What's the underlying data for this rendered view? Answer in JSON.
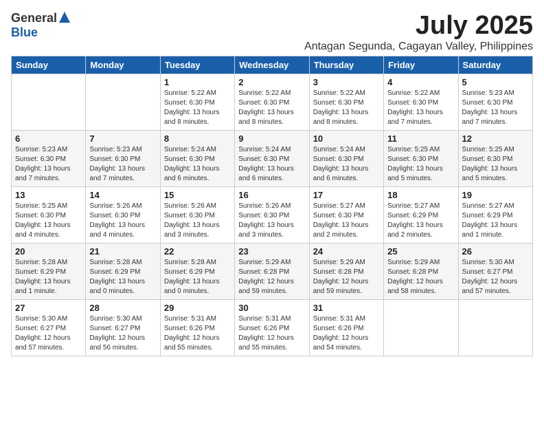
{
  "logo": {
    "general": "General",
    "blue": "Blue"
  },
  "title": "July 2025",
  "subtitle": "Antagan Segunda, Cagayan Valley, Philippines",
  "weekdays": [
    "Sunday",
    "Monday",
    "Tuesday",
    "Wednesday",
    "Thursday",
    "Friday",
    "Saturday"
  ],
  "weeks": [
    [
      {
        "day": null,
        "info": null
      },
      {
        "day": null,
        "info": null
      },
      {
        "day": "1",
        "info": "Sunrise: 5:22 AM\nSunset: 6:30 PM\nDaylight: 13 hours and 8 minutes."
      },
      {
        "day": "2",
        "info": "Sunrise: 5:22 AM\nSunset: 6:30 PM\nDaylight: 13 hours and 8 minutes."
      },
      {
        "day": "3",
        "info": "Sunrise: 5:22 AM\nSunset: 6:30 PM\nDaylight: 13 hours and 8 minutes."
      },
      {
        "day": "4",
        "info": "Sunrise: 5:22 AM\nSunset: 6:30 PM\nDaylight: 13 hours and 7 minutes."
      },
      {
        "day": "5",
        "info": "Sunrise: 5:23 AM\nSunset: 6:30 PM\nDaylight: 13 hours and 7 minutes."
      }
    ],
    [
      {
        "day": "6",
        "info": "Sunrise: 5:23 AM\nSunset: 6:30 PM\nDaylight: 13 hours and 7 minutes."
      },
      {
        "day": "7",
        "info": "Sunrise: 5:23 AM\nSunset: 6:30 PM\nDaylight: 13 hours and 7 minutes."
      },
      {
        "day": "8",
        "info": "Sunrise: 5:24 AM\nSunset: 6:30 PM\nDaylight: 13 hours and 6 minutes."
      },
      {
        "day": "9",
        "info": "Sunrise: 5:24 AM\nSunset: 6:30 PM\nDaylight: 13 hours and 6 minutes."
      },
      {
        "day": "10",
        "info": "Sunrise: 5:24 AM\nSunset: 6:30 PM\nDaylight: 13 hours and 6 minutes."
      },
      {
        "day": "11",
        "info": "Sunrise: 5:25 AM\nSunset: 6:30 PM\nDaylight: 13 hours and 5 minutes."
      },
      {
        "day": "12",
        "info": "Sunrise: 5:25 AM\nSunset: 6:30 PM\nDaylight: 13 hours and 5 minutes."
      }
    ],
    [
      {
        "day": "13",
        "info": "Sunrise: 5:25 AM\nSunset: 6:30 PM\nDaylight: 13 hours and 4 minutes."
      },
      {
        "day": "14",
        "info": "Sunrise: 5:26 AM\nSunset: 6:30 PM\nDaylight: 13 hours and 4 minutes."
      },
      {
        "day": "15",
        "info": "Sunrise: 5:26 AM\nSunset: 6:30 PM\nDaylight: 13 hours and 3 minutes."
      },
      {
        "day": "16",
        "info": "Sunrise: 5:26 AM\nSunset: 6:30 PM\nDaylight: 13 hours and 3 minutes."
      },
      {
        "day": "17",
        "info": "Sunrise: 5:27 AM\nSunset: 6:30 PM\nDaylight: 13 hours and 2 minutes."
      },
      {
        "day": "18",
        "info": "Sunrise: 5:27 AM\nSunset: 6:29 PM\nDaylight: 13 hours and 2 minutes."
      },
      {
        "day": "19",
        "info": "Sunrise: 5:27 AM\nSunset: 6:29 PM\nDaylight: 13 hours and 1 minute."
      }
    ],
    [
      {
        "day": "20",
        "info": "Sunrise: 5:28 AM\nSunset: 6:29 PM\nDaylight: 13 hours and 1 minute."
      },
      {
        "day": "21",
        "info": "Sunrise: 5:28 AM\nSunset: 6:29 PM\nDaylight: 13 hours and 0 minutes."
      },
      {
        "day": "22",
        "info": "Sunrise: 5:28 AM\nSunset: 6:29 PM\nDaylight: 13 hours and 0 minutes."
      },
      {
        "day": "23",
        "info": "Sunrise: 5:29 AM\nSunset: 6:28 PM\nDaylight: 12 hours and 59 minutes."
      },
      {
        "day": "24",
        "info": "Sunrise: 5:29 AM\nSunset: 6:28 PM\nDaylight: 12 hours and 59 minutes."
      },
      {
        "day": "25",
        "info": "Sunrise: 5:29 AM\nSunset: 6:28 PM\nDaylight: 12 hours and 58 minutes."
      },
      {
        "day": "26",
        "info": "Sunrise: 5:30 AM\nSunset: 6:27 PM\nDaylight: 12 hours and 57 minutes."
      }
    ],
    [
      {
        "day": "27",
        "info": "Sunrise: 5:30 AM\nSunset: 6:27 PM\nDaylight: 12 hours and 57 minutes."
      },
      {
        "day": "28",
        "info": "Sunrise: 5:30 AM\nSunset: 6:27 PM\nDaylight: 12 hours and 56 minutes."
      },
      {
        "day": "29",
        "info": "Sunrise: 5:31 AM\nSunset: 6:26 PM\nDaylight: 12 hours and 55 minutes."
      },
      {
        "day": "30",
        "info": "Sunrise: 5:31 AM\nSunset: 6:26 PM\nDaylight: 12 hours and 55 minutes."
      },
      {
        "day": "31",
        "info": "Sunrise: 5:31 AM\nSunset: 6:26 PM\nDaylight: 12 hours and 54 minutes."
      },
      {
        "day": null,
        "info": null
      },
      {
        "day": null,
        "info": null
      }
    ]
  ]
}
